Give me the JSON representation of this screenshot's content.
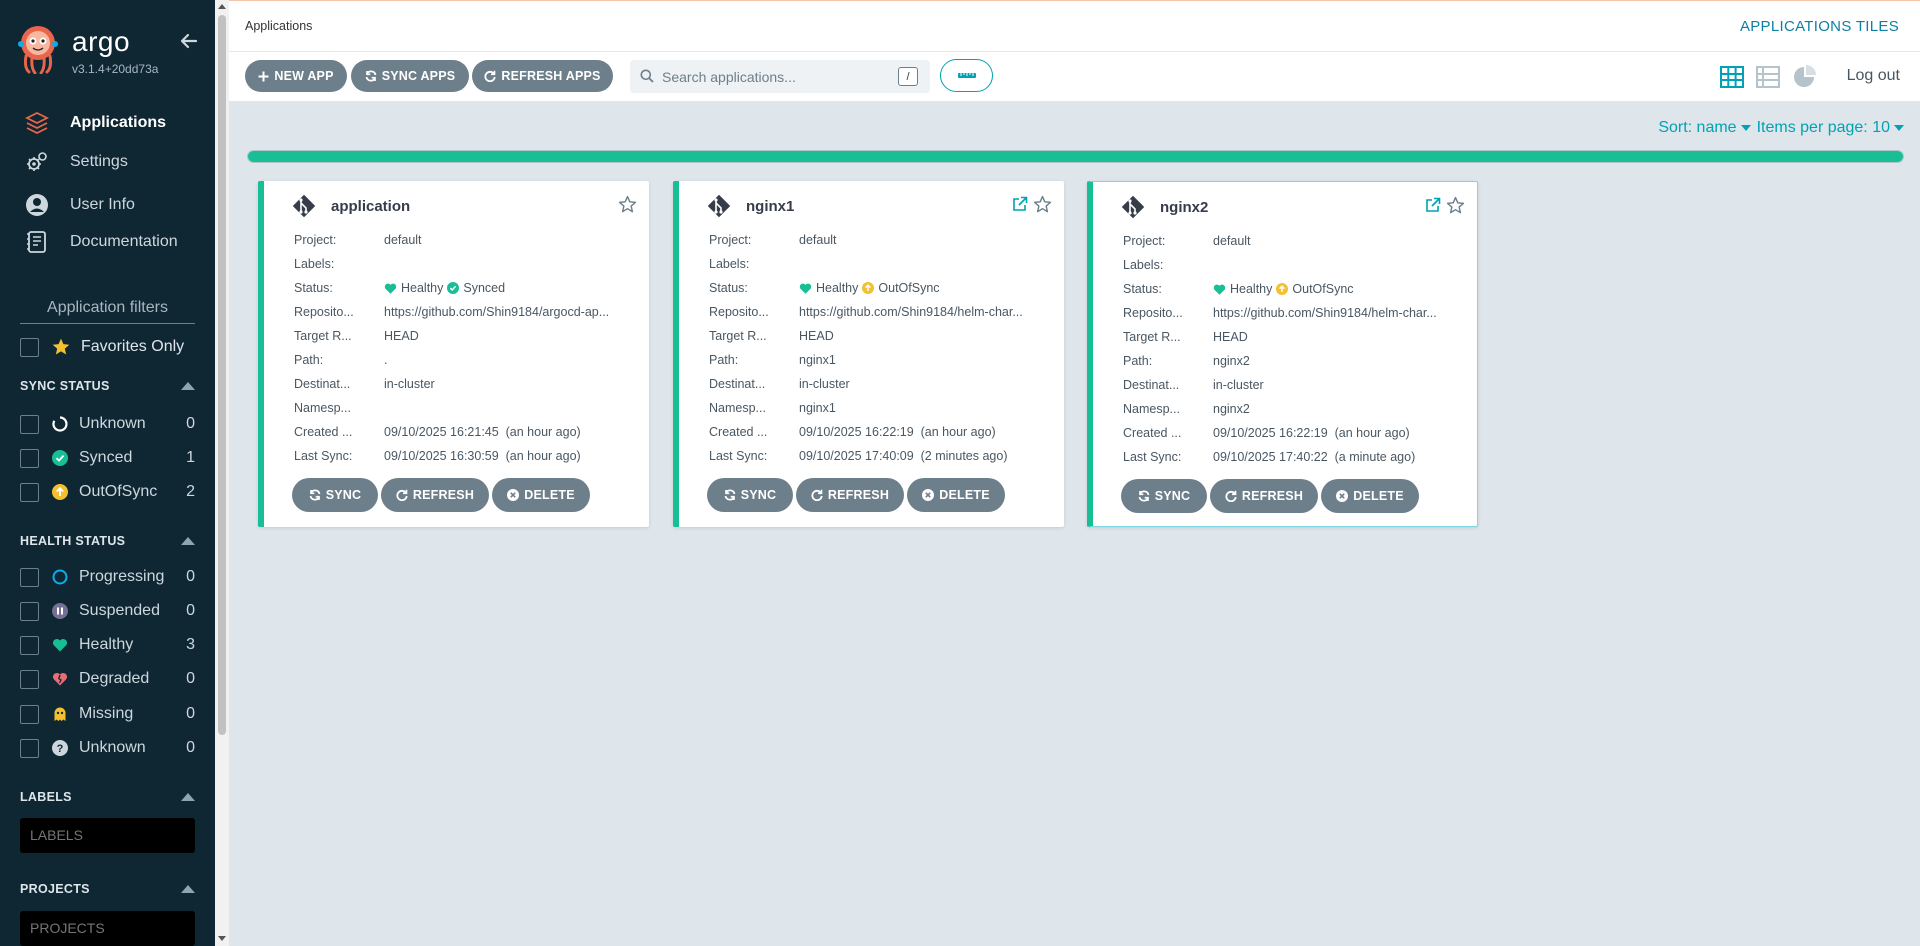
{
  "brand": {
    "name": "argo",
    "version": "v3.1.4+20dd73a"
  },
  "nav": [
    {
      "label": "Applications",
      "icon": "layers-icon"
    },
    {
      "label": "Settings",
      "icon": "gears-icon"
    },
    {
      "label": "User Info",
      "icon": "user-circle-icon"
    },
    {
      "label": "Documentation",
      "icon": "book-icon"
    }
  ],
  "filters": {
    "title": "Application filters",
    "favorites_label": "Favorites Only",
    "sync_title": "SYNC STATUS",
    "sync": [
      {
        "label": "Unknown",
        "count": "0",
        "icon": "circle-notch-icon"
      },
      {
        "label": "Synced",
        "count": "1",
        "icon": "check-circle-icon",
        "color": "#18be94"
      },
      {
        "label": "OutOfSync",
        "count": "2",
        "icon": "arrow-up-circle-icon",
        "color": "#f4c030"
      }
    ],
    "health_title": "HEALTH STATUS",
    "health": [
      {
        "label": "Progressing",
        "count": "0",
        "icon": "progress-circle-icon",
        "color": "#0dadea"
      },
      {
        "label": "Suspended",
        "count": "0",
        "icon": "pause-circle-icon",
        "color": "#766f94"
      },
      {
        "label": "Healthy",
        "count": "3",
        "icon": "heart-icon",
        "color": "#18be94"
      },
      {
        "label": "Degraded",
        "count": "0",
        "icon": "heart-broken-icon",
        "color": "#e96d76"
      },
      {
        "label": "Missing",
        "count": "0",
        "icon": "ghost-icon",
        "color": "#f4c030"
      },
      {
        "label": "Unknown",
        "count": "0",
        "icon": "question-circle-icon",
        "color": "#ccd6dd"
      }
    ],
    "labels_title": "LABELS",
    "labels_placeholder": "LABELS",
    "projects_title": "PROJECTS",
    "projects_placeholder": "PROJECTS"
  },
  "header": {
    "breadcrumb": "Applications",
    "title": "APPLICATIONS TILES"
  },
  "toolbar": {
    "new_app": "NEW APP",
    "sync_apps": "SYNC APPS",
    "refresh_apps": "REFRESH APPS",
    "search_placeholder": "Search applications...",
    "search_shortcut": "/",
    "logout": "Log out"
  },
  "sort": {
    "sort_label": "Sort: name",
    "per_page_label": "Items per page: 10"
  },
  "progress": {
    "fraction": 1.0,
    "color": "#18be94"
  },
  "labels": {
    "project": "Project:",
    "labels": "Labels:",
    "status": "Status:",
    "repository": "Reposito...",
    "target": "Target R...",
    "path": "Path:",
    "destination": "Destinat...",
    "namespace": "Namesp...",
    "created": "Created ...",
    "last_sync": "Last Sync:"
  },
  "card_buttons": {
    "sync": "SYNC",
    "refresh": "REFRESH",
    "delete": "DELETE"
  },
  "apps": [
    {
      "name": "application",
      "project": "default",
      "labels": "",
      "health": "Healthy",
      "sync": "Synced",
      "sync_color": "#18be94",
      "repository": "https://github.com/Shin9184/argocd-ap...",
      "target": "HEAD",
      "path": ".",
      "destination": "in-cluster",
      "namespace": "",
      "created": "09/10/2025 16:21:45  (an hour ago)",
      "last_sync": "09/10/2025 16:30:59  (an hour ago)",
      "has_link": false,
      "highlighted": false
    },
    {
      "name": "nginx1",
      "project": "default",
      "labels": "",
      "health": "Healthy",
      "sync": "OutOfSync",
      "sync_color": "#f4c030",
      "repository": "https://github.com/Shin9184/helm-char...",
      "target": "HEAD",
      "path": "nginx1",
      "destination": "in-cluster",
      "namespace": "nginx1",
      "created": "09/10/2025 16:22:19  (an hour ago)",
      "last_sync": "09/10/2025 17:40:09  (2 minutes ago)",
      "has_link": true,
      "highlighted": false
    },
    {
      "name": "nginx2",
      "project": "default",
      "labels": "",
      "health": "Healthy",
      "sync": "OutOfSync",
      "sync_color": "#f4c030",
      "repository": "https://github.com/Shin9184/helm-char...",
      "target": "HEAD",
      "path": "nginx2",
      "destination": "in-cluster",
      "namespace": "nginx2",
      "created": "09/10/2025 16:22:19  (an hour ago)",
      "last_sync": "09/10/2025 17:40:22  (a minute ago)",
      "has_link": true,
      "highlighted": true
    }
  ]
}
